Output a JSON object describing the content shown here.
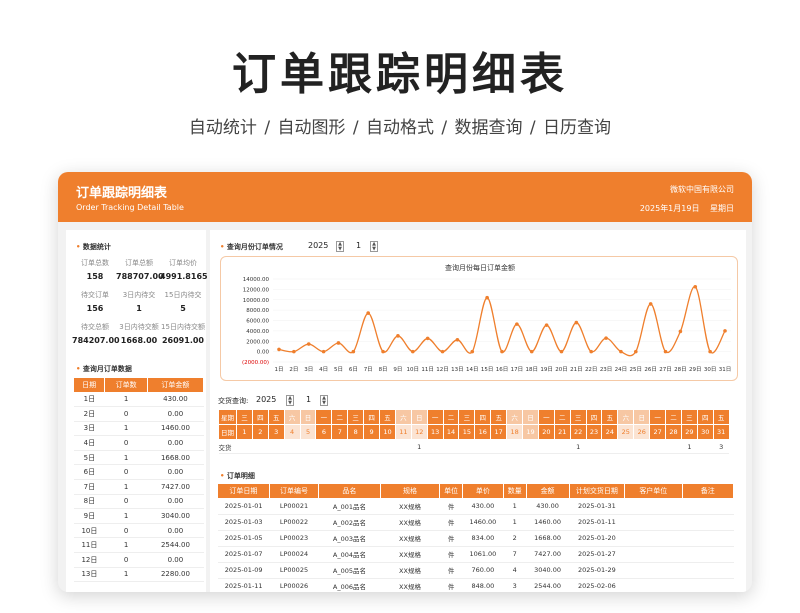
{
  "hero": {
    "title": "订单跟踪明细表",
    "subtitle": "自动统计  /  自动图形  /  自动格式  /  数据查询  /  日历查询"
  },
  "header": {
    "title": "订单跟踪明细表",
    "subtitle": "Order Tracking Detail Table",
    "company": "微软中国有限公司",
    "date": "2025年1月19日 星期日"
  },
  "stats": {
    "section": "数据统计",
    "items": [
      {
        "label": "订单总数",
        "value": "158"
      },
      {
        "label": "订单总额",
        "value": "788707.00"
      },
      {
        "label": "订单均价",
        "value": "4991.8165"
      },
      {
        "label": "待交订单",
        "value": "156"
      },
      {
        "label": "3日内待交",
        "value": "1"
      },
      {
        "label": "15日内待交",
        "value": "5"
      },
      {
        "label": "待交总额",
        "value": "784207.00"
      },
      {
        "label": "3日内待交额",
        "value": "1668.00"
      },
      {
        "label": "15日内待交额",
        "value": "26091.00"
      }
    ]
  },
  "monthly": {
    "section": "查询月订单数据",
    "headers": [
      "日期",
      "订单数",
      "订单金额"
    ],
    "rows": [
      [
        "1日",
        "1",
        "430.00"
      ],
      [
        "2日",
        "0",
        "0.00"
      ],
      [
        "3日",
        "1",
        "1460.00"
      ],
      [
        "4日",
        "0",
        "0.00"
      ],
      [
        "5日",
        "1",
        "1668.00"
      ],
      [
        "6日",
        "0",
        "0.00"
      ],
      [
        "7日",
        "1",
        "7427.00"
      ],
      [
        "8日",
        "0",
        "0.00"
      ],
      [
        "9日",
        "1",
        "3040.00"
      ],
      [
        "10日",
        "0",
        "0.00"
      ],
      [
        "11日",
        "1",
        "2544.00"
      ],
      [
        "12日",
        "0",
        "0.00"
      ],
      [
        "13日",
        "1",
        "2280.00"
      ]
    ]
  },
  "query": {
    "section": "查询月份订单情况",
    "year": "2025",
    "month": "1"
  },
  "chart_data": {
    "type": "line",
    "title": "查询月份每日订单金额",
    "categories": [
      "1日",
      "2日",
      "3日",
      "4日",
      "5日",
      "6日",
      "7日",
      "8日",
      "9日",
      "10日",
      "11日",
      "12日",
      "13日",
      "14日",
      "15日",
      "16日",
      "17日",
      "18日",
      "19日",
      "20日",
      "21日",
      "22日",
      "23日",
      "24日",
      "25日",
      "26日",
      "27日",
      "28日",
      "29日",
      "30日",
      "31日"
    ],
    "values": [
      430,
      0,
      1460,
      0,
      1668,
      0,
      7427,
      0,
      3040,
      0,
      2544,
      0,
      2280,
      0,
      10400,
      0,
      5300,
      0,
      5100,
      0,
      5600,
      0,
      2600,
      0,
      0,
      9200,
      0,
      3900,
      12500,
      0,
      4000
    ],
    "yticks": [
      "14000.00",
      "12000.00",
      "10000.00",
      "8000.00",
      "6000.00",
      "4000.00",
      "2000.00",
      "0.00",
      "(2000.00)"
    ],
    "ylim": [
      -2000,
      14000
    ],
    "color": "#ef7f2d"
  },
  "calendar": {
    "label": "交货查询:",
    "year": "2025",
    "month": "1",
    "row_week": "星期",
    "row_date": "日期",
    "row_delivery": "交货",
    "weekdays": [
      "三",
      "四",
      "五",
      "六",
      "日",
      "一",
      "二",
      "三",
      "四",
      "五",
      "六",
      "日",
      "一",
      "二",
      "三",
      "四",
      "五",
      "六",
      "日",
      "一",
      "二",
      "三",
      "四",
      "五",
      "六",
      "日",
      "一",
      "二",
      "三",
      "四",
      "五"
    ],
    "dates": [
      "1",
      "2",
      "3",
      "4",
      "5",
      "6",
      "7",
      "8",
      "9",
      "10",
      "11",
      "12",
      "13",
      "14",
      "15",
      "16",
      "17",
      "18",
      "19",
      "20",
      "21",
      "22",
      "23",
      "24",
      "25",
      "26",
      "27",
      "28",
      "29",
      "30",
      "31"
    ],
    "delivery": [
      "",
      "",
      "",
      "",
      "",
      "",
      "",
      "",
      "",
      "",
      "",
      "1",
      "",
      "",
      "",
      "",
      "",
      "",
      "",
      "",
      "",
      "1",
      "",
      "",
      "",
      "",
      "",
      "",
      "1",
      "",
      "3"
    ]
  },
  "orders": {
    "section": "订单明细",
    "headers": [
      "订单日期",
      "订单编号",
      "品名",
      "规格",
      "单位",
      "单价",
      "数量",
      "金额",
      "计划交货日期",
      "客户单位",
      "备注"
    ],
    "rows": [
      [
        "2025-01-01",
        "LP00021",
        "A_001品名",
        "XX规格",
        "件",
        "430.00",
        "1",
        "430.00",
        "2025-01-31",
        "",
        ""
      ],
      [
        "2025-01-03",
        "LP00022",
        "A_002品名",
        "XX规格",
        "件",
        "1460.00",
        "1",
        "1460.00",
        "2025-01-11",
        "",
        ""
      ],
      [
        "2025-01-05",
        "LP00023",
        "A_003品名",
        "XX规格",
        "件",
        "834.00",
        "2",
        "1668.00",
        "2025-01-20",
        "",
        ""
      ],
      [
        "2025-01-07",
        "LP00024",
        "A_004品名",
        "XX规格",
        "件",
        "1061.00",
        "7",
        "7427.00",
        "2025-01-27",
        "",
        ""
      ],
      [
        "2025-01-09",
        "LP00025",
        "A_005品名",
        "XX规格",
        "件",
        "760.00",
        "4",
        "3040.00",
        "2025-01-29",
        "",
        ""
      ],
      [
        "2025-01-11",
        "LP00026",
        "A_006品名",
        "XX规格",
        "件",
        "848.00",
        "3",
        "2544.00",
        "2025-02-06",
        "",
        ""
      ]
    ]
  }
}
